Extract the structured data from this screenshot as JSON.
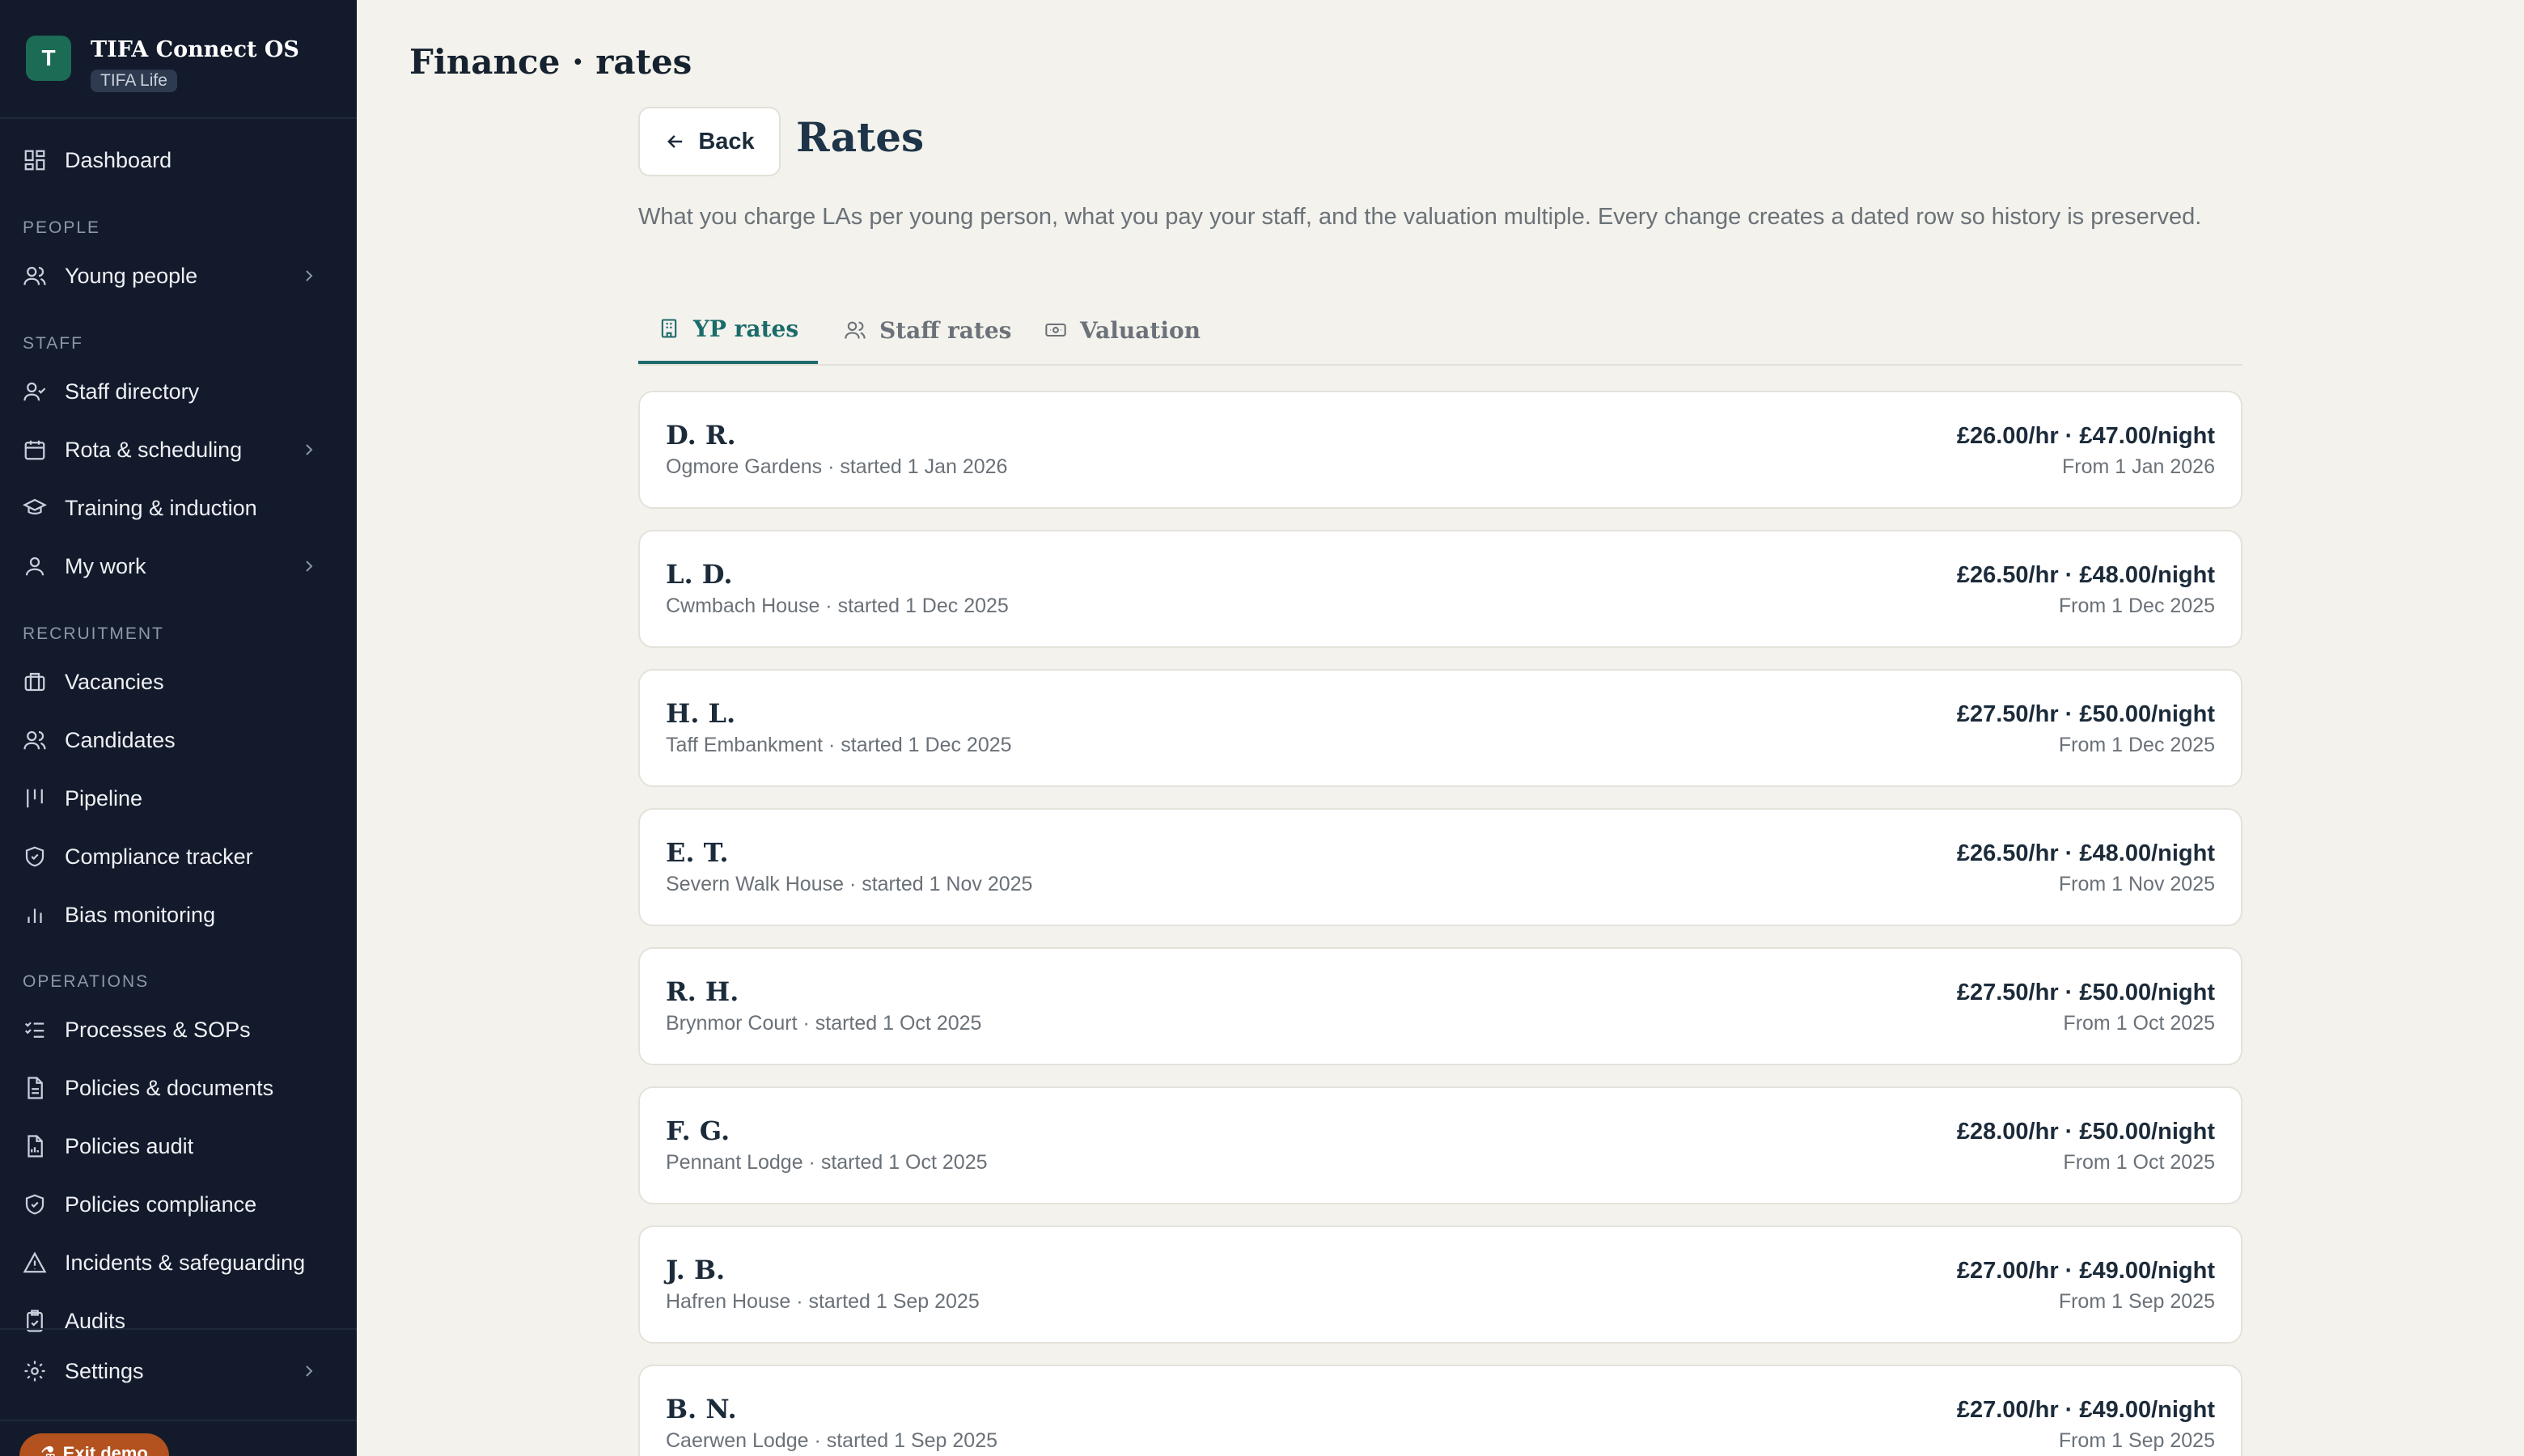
{
  "brand": {
    "logo_letter": "T",
    "title": "TIFA Connect OS",
    "badge": "TIFA Life"
  },
  "sidebar": {
    "dashboard": "Dashboard",
    "section_people": "PEOPLE",
    "young_people": "Young people",
    "section_staff": "STAFF",
    "staff_directory": "Staff directory",
    "rota": "Rota & scheduling",
    "training": "Training & induction",
    "my_work": "My work",
    "section_recruitment": "RECRUITMENT",
    "vacancies": "Vacancies",
    "candidates": "Candidates",
    "pipeline": "Pipeline",
    "compliance_tracker": "Compliance tracker",
    "bias_monitoring": "Bias monitoring",
    "section_operations": "OPERATIONS",
    "processes": "Processes & SOPs",
    "policies_documents": "Policies & documents",
    "policies_audit": "Policies audit",
    "policies_compliance": "Policies compliance",
    "incidents": "Incidents & safeguarding",
    "audits": "Audits",
    "settings": "Settings",
    "exit_demo": "Exit demo"
  },
  "header": {
    "page_title": "Finance · rates",
    "back_label": "Back",
    "title": "Rates"
  },
  "description": "What you charge LAs per young person, what you pay your staff, and the valuation multiple. Every change creates a dated row so history is preserved.",
  "tabs": {
    "yp": "YP rates",
    "staff": "Staff rates",
    "valuation": "Valuation"
  },
  "rates": [
    {
      "name": "D. R.",
      "sub": "Ogmore Gardens · started 1 Jan 2026",
      "rate": "£26.00/hr · £47.00/night",
      "from": "From 1 Jan 2026"
    },
    {
      "name": "L. D.",
      "sub": "Cwmbach House · started 1 Dec 2025",
      "rate": "£26.50/hr · £48.00/night",
      "from": "From 1 Dec 2025"
    },
    {
      "name": "H. L.",
      "sub": "Taff Embankment · started 1 Dec 2025",
      "rate": "£27.50/hr · £50.00/night",
      "from": "From 1 Dec 2025"
    },
    {
      "name": "E. T.",
      "sub": "Severn Walk House · started 1 Nov 2025",
      "rate": "£26.50/hr · £48.00/night",
      "from": "From 1 Nov 2025"
    },
    {
      "name": "R. H.",
      "sub": "Brynmor Court · started 1 Oct 2025",
      "rate": "£27.50/hr · £50.00/night",
      "from": "From 1 Oct 2025"
    },
    {
      "name": "F. G.",
      "sub": "Pennant Lodge · started 1 Oct 2025",
      "rate": "£28.00/hr · £50.00/night",
      "from": "From 1 Oct 2025"
    },
    {
      "name": "J. B.",
      "sub": "Hafren House · started 1 Sep 2025",
      "rate": "£27.00/hr · £49.00/night",
      "from": "From 1 Sep 2025"
    },
    {
      "name": "B. N.",
      "sub": "Caerwen Lodge · started 1 Sep 2025",
      "rate": "£27.00/hr · £49.00/night",
      "from": "From 1 Sep 2025"
    }
  ]
}
